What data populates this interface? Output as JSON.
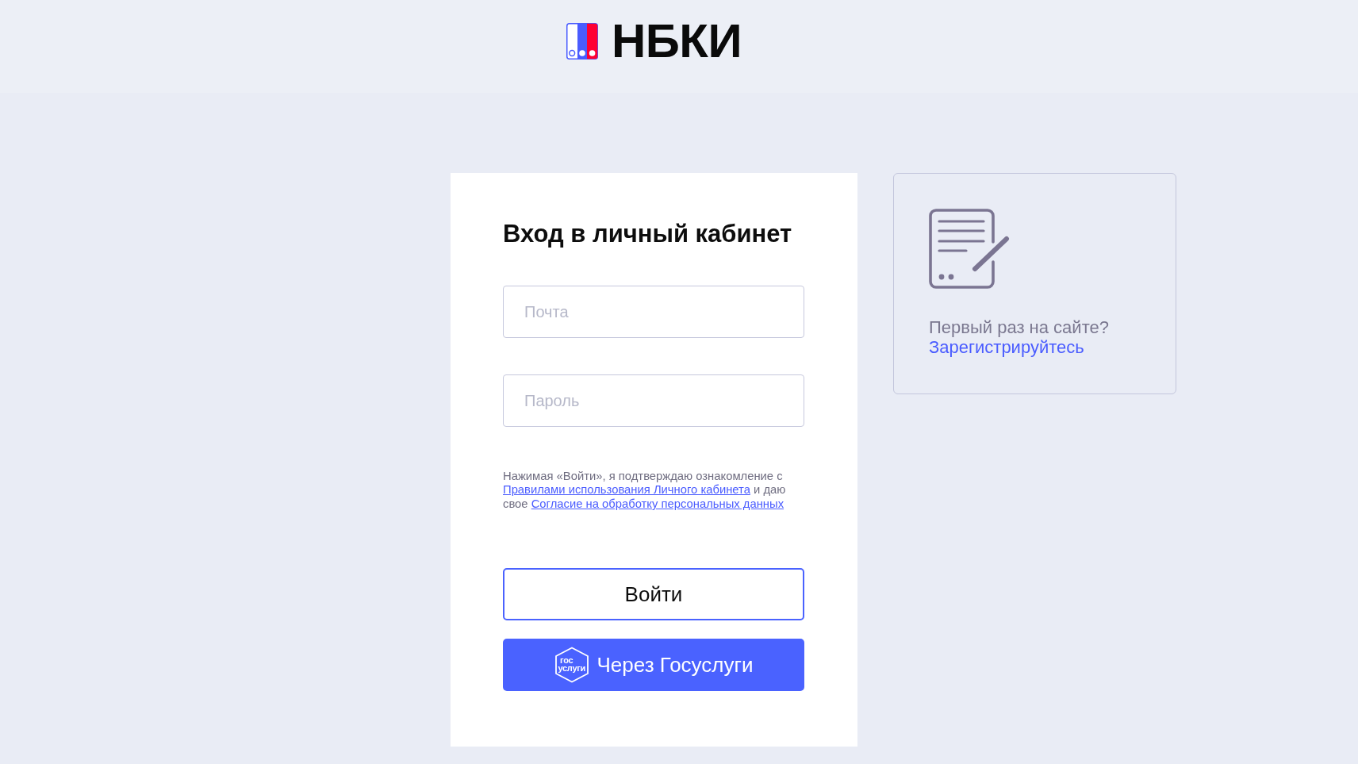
{
  "header": {
    "logo_text": "НБКИ"
  },
  "login_form": {
    "title": "Вход в личный кабинет",
    "fields": [
      {
        "placeholder": "Почта"
      },
      {
        "placeholder": "Пароль"
      }
    ],
    "consent": {
      "text_before": "Нажимая «Войти», я подтверждаю ознакомление с",
      "rules_link": "Правилами использования Личного кабинета",
      "text_middle": "и даю свое",
      "consent_link": "Согласие на обработку персональных данных"
    },
    "buttons": [
      {
        "kind": "outline",
        "label": "Войти"
      },
      {
        "kind": "filled",
        "label": "Через Госуслуги",
        "badge_text": [
          "гос",
          "услуги"
        ]
      }
    ]
  },
  "register_card": {
    "question": "Первый раз на сайте?",
    "link": "Зарегистрируйтесь"
  }
}
